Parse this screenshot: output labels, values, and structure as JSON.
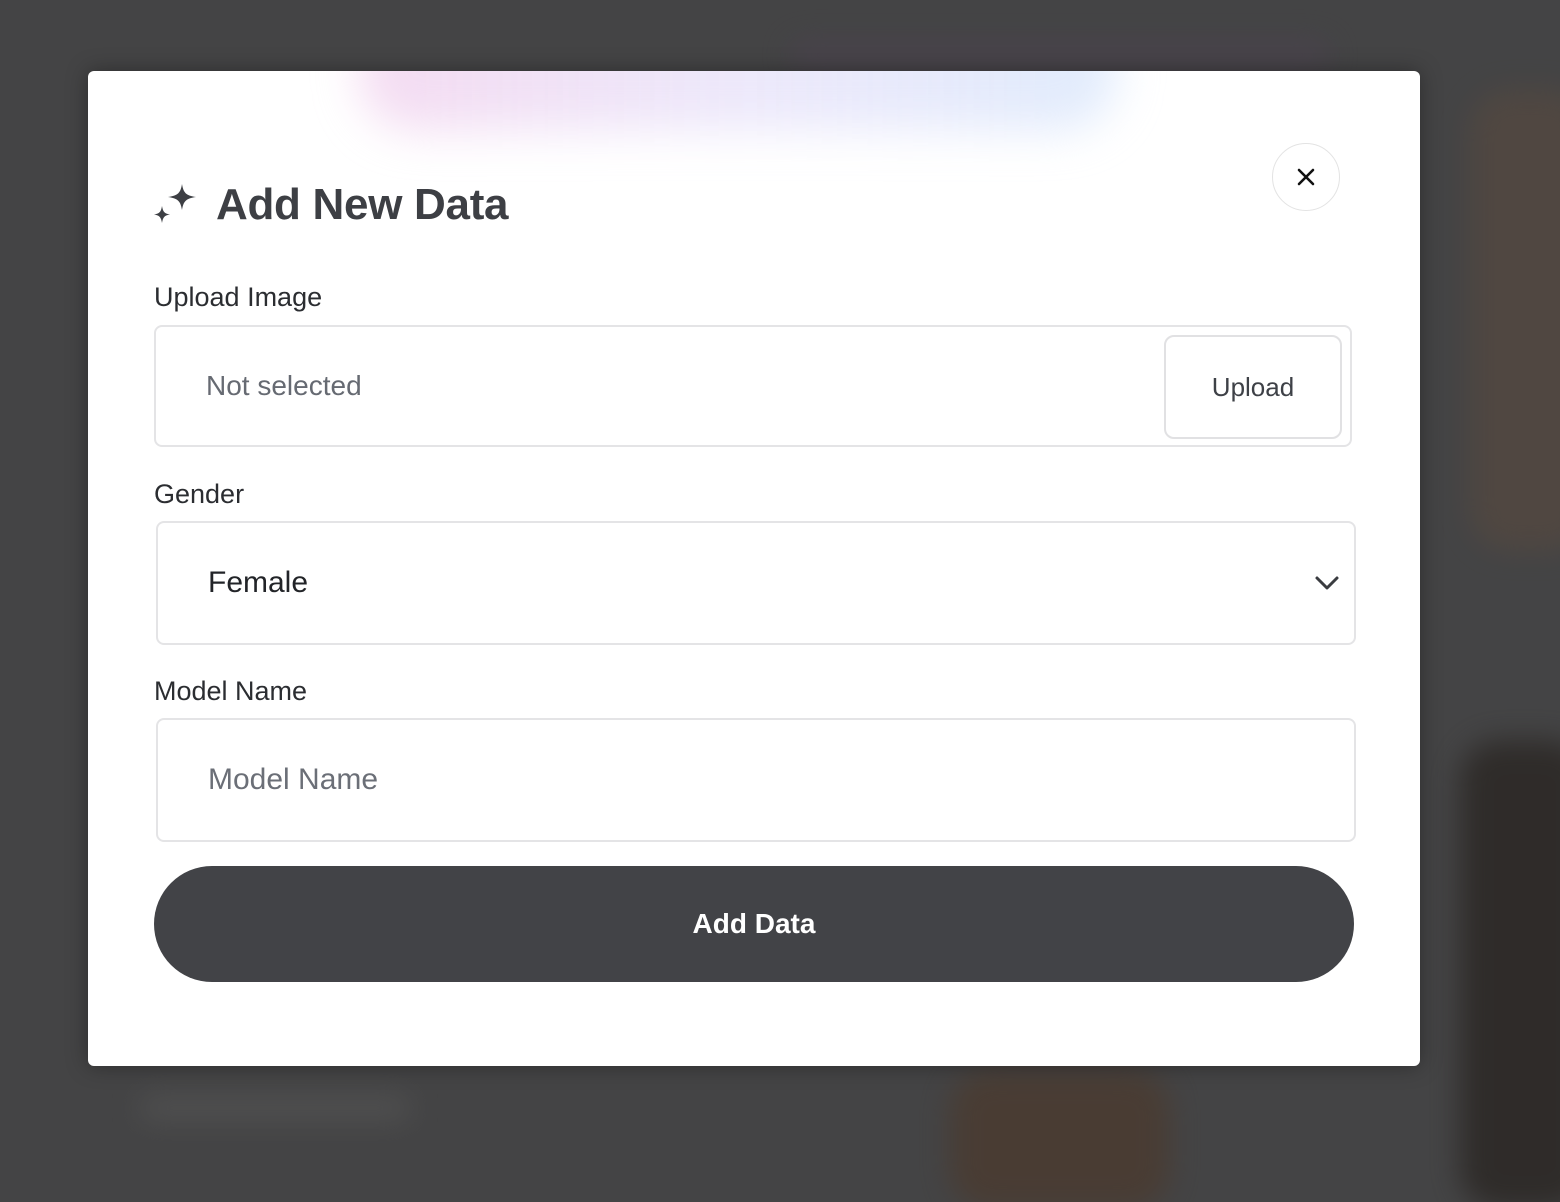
{
  "modal": {
    "title": "Add New Data",
    "title_icon": "sparkles-icon",
    "close_icon": "close-icon"
  },
  "upload": {
    "label": "Upload Image",
    "status": "Not selected",
    "button_label": "Upload"
  },
  "gender": {
    "label": "Gender",
    "selected": "Female",
    "dropdown_icon": "chevron-down-icon"
  },
  "model_name": {
    "label": "Model Name",
    "placeholder": "Model Name",
    "value": ""
  },
  "submit": {
    "label": "Add Data"
  },
  "colors": {
    "primary_button": "#424347",
    "title_text": "#3d3f44",
    "overlay": "#444445"
  }
}
